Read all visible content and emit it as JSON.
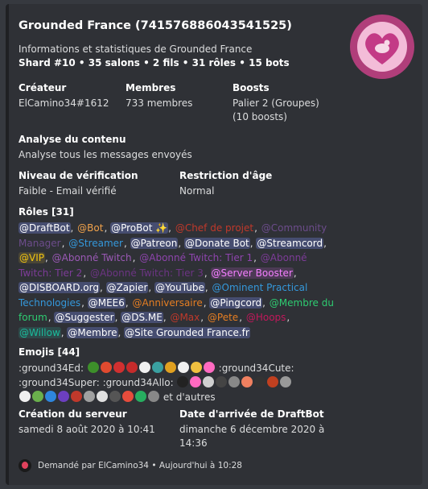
{
  "title": "Grounded France (741576886043541525)",
  "description": "Informations et statistiques de Grounded France",
  "stats": "Shard #10 • 35 salons • 2 fils • 31 rôles • 15 bots",
  "fields": {
    "creator": {
      "name": "Créateur",
      "value": "ElCamino34#1612"
    },
    "members": {
      "name": "Membres",
      "value": "733 membres"
    },
    "boosts": {
      "name": "Boosts",
      "value1": "Palier 2 (Groupes)",
      "value2": "(10 boosts)"
    },
    "content": {
      "name": "Analyse du contenu",
      "value": "Analyse tous les messages envoyés"
    },
    "verification": {
      "name": "Niveau de vérification",
      "value": "Faible - Email vérifié"
    },
    "age": {
      "name": "Restriction d'âge",
      "value": "Normal"
    },
    "created": {
      "name": "Création du serveur",
      "value": "samedi 8 août 2020 à 10:41"
    },
    "joined": {
      "name": "Date d'arrivée de DraftBot",
      "value1": "dimanche 6 décembre 2020 à",
      "value2": "14:36"
    }
  },
  "roles_title": "Rôles [31]",
  "roles": [
    {
      "label": "@DraftBot",
      "color": "#ffffff",
      "bg": "#464d70"
    },
    {
      "label": "@Bot",
      "color": "#f1a24b",
      "bg": "transparent"
    },
    {
      "label": "@ProBot ✨",
      "color": "#ffffff",
      "bg": "#464d70"
    },
    {
      "label": "@Chef de projet",
      "color": "#c0392b",
      "bg": "transparent"
    },
    {
      "label": "@Community Manager",
      "color": "#6c4c8b",
      "bg": "transparent"
    },
    {
      "label": "@Streamer",
      "color": "#3498db",
      "bg": "transparent"
    },
    {
      "label": "@Patreon",
      "color": "#ffffff",
      "bg": "#464d70"
    },
    {
      "label": "@Donate Bot",
      "color": "#ffffff",
      "bg": "#464d70"
    },
    {
      "label": "@Streamcord",
      "color": "#ffffff",
      "bg": "#464d70"
    },
    {
      "label": "@VIP",
      "color": "#f1c40f",
      "bg": "#4a4636"
    },
    {
      "label": "@Abonné Twitch",
      "color": "#9b59b6",
      "bg": "transparent"
    },
    {
      "label": "@Abonné Twitch: Tier 1",
      "color": "#8e44ad",
      "bg": "transparent"
    },
    {
      "label": "@Abonné Twitch: Tier 2",
      "color": "#7d3c98",
      "bg": "transparent"
    },
    {
      "label": "@Abonné Twitch: Tier 3",
      "color": "#6c3483",
      "bg": "transparent"
    },
    {
      "label": "@Server Booster",
      "color": "#f47fff",
      "bg": "#4c3a55"
    },
    {
      "label": "@DISBOARD.org",
      "color": "#ffffff",
      "bg": "#464d70"
    },
    {
      "label": "@Zapier",
      "color": "#ffffff",
      "bg": "#464d70"
    },
    {
      "label": "@YouTube",
      "color": "#ffffff",
      "bg": "#464d70"
    },
    {
      "label": "@Ominent Practical Technologies",
      "color": "#3498db",
      "bg": "transparent"
    },
    {
      "label": "@MEE6",
      "color": "#ffffff",
      "bg": "#464d70"
    },
    {
      "label": "@Anniversaire",
      "color": "#e67e22",
      "bg": "transparent"
    },
    {
      "label": "@Pingcord",
      "color": "#ffffff",
      "bg": "#464d70"
    },
    {
      "label": "@Membre du forum",
      "color": "#2ecc71",
      "bg": "transparent"
    },
    {
      "label": "@Suggester",
      "color": "#ffffff",
      "bg": "#464d70"
    },
    {
      "label": "@DS.ME",
      "color": "#ffffff",
      "bg": "#464d70"
    },
    {
      "label": "@Max",
      "color": "#c0392b",
      "bg": "transparent"
    },
    {
      "label": "@Pete",
      "color": "#e67e22",
      "bg": "transparent"
    },
    {
      "label": "@Hoops",
      "color": "#c2185b",
      "bg": "transparent"
    },
    {
      "label": "@Willow",
      "color": "#1abc9c",
      "bg": "#2e4a4a"
    },
    {
      "label": "@Membre",
      "color": "#ffffff",
      "bg": "#464d70"
    },
    {
      "label": "@Site Grounded France.fr",
      "color": "#ffffff",
      "bg": "#464d70"
    }
  ],
  "emojis_title": "Emojis [44]",
  "emojis": {
    "text1": ":ground34Ed:",
    "text2": ":ground34Cute:",
    "text3": ":ground34Super:",
    "text4": ":ground34Allo:",
    "tail": "et d'autres",
    "row1_colors": [
      "#3d8f2a",
      "#e04a2f",
      "#d03030",
      "#c52b2b",
      "#f0f0f0",
      "#3aa0a0",
      "#e0a020",
      "#f0f0f0",
      "#f0c040",
      "#ff6ac1"
    ],
    "row2_colors": [
      "#222222",
      "#ff6ac1",
      "#d0d0d0",
      "#444444",
      "#888888",
      "#f08060",
      "#333333",
      "#c04020",
      "#999999"
    ],
    "row3_colors": [
      "#f0f0f0",
      "#6ab04c",
      "#2e86de",
      "#6c3fc0",
      "#c0392b",
      "#a0a0a0",
      "#e0e0e0",
      "#555555",
      "#e74c3c",
      "#27ae60",
      "#888888"
    ]
  },
  "footer": "Demandé par ElCamino34 • Aujourd'hui à 10:28"
}
